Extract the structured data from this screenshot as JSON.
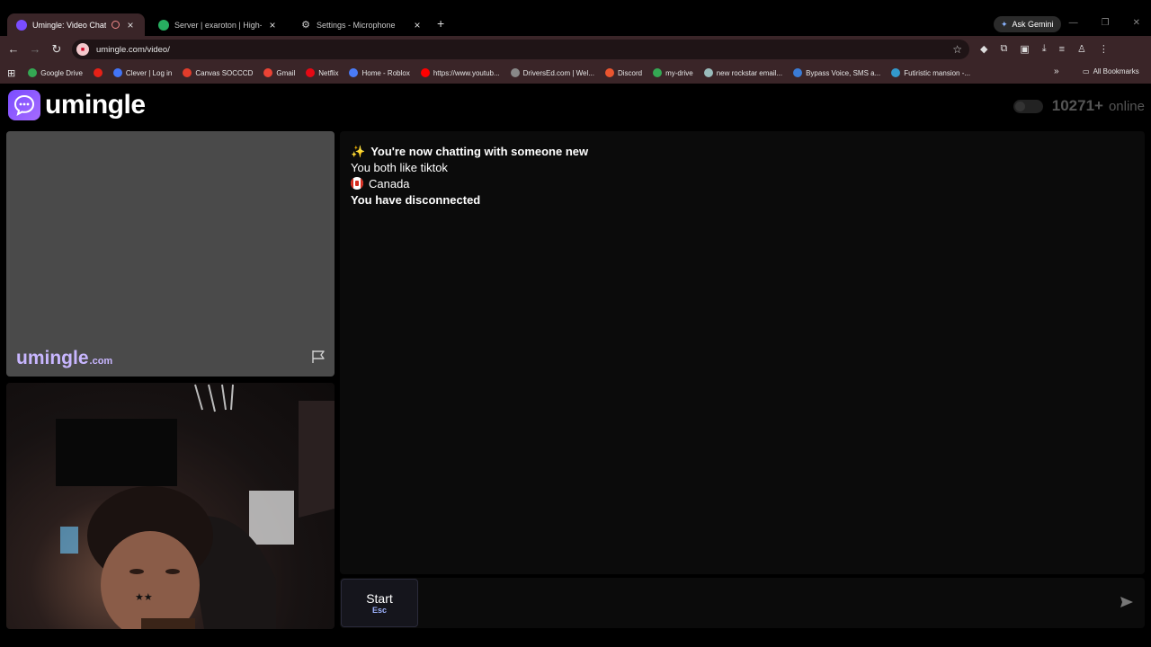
{
  "browser": {
    "tabs": [
      {
        "title": "Umingle: Video Chat with St",
        "active": true,
        "recording": true
      },
      {
        "title": "Server | exaroton | High-end on",
        "active": false
      },
      {
        "title": "Settings - Microphone",
        "active": false
      }
    ],
    "new_tab": "+",
    "gemini_label": "Ask Gemini",
    "url": "umingle.com/video/",
    "bookmarks": [
      {
        "label": "Google Drive",
        "color": "#34a853"
      },
      {
        "label": "",
        "color": "#e62117"
      },
      {
        "label": "Clever | Log in",
        "color": "#4274f6"
      },
      {
        "label": "Canvas SOCCCD",
        "color": "#e13c2b"
      },
      {
        "label": "Gmail",
        "color": "#ea4335"
      },
      {
        "label": "Netflix",
        "color": "#e50914"
      },
      {
        "label": "Home - Roblox",
        "color": "#4a7bf7"
      },
      {
        "label": "https://www.youtub...",
        "color": "#ff0000"
      },
      {
        "label": "DriversEd.com | Wel...",
        "color": "#888888"
      },
      {
        "label": "Discord",
        "color": "#e9552f"
      },
      {
        "label": "my-drive",
        "color": "#34a853"
      },
      {
        "label": "new rockstar email...",
        "color": "#9bb"
      },
      {
        "label": "Bypass Voice, SMS a...",
        "color": "#3a7bd5"
      },
      {
        "label": "Futiristic mansion -...",
        "color": "#3399cc"
      }
    ],
    "more_bookmarks": "»",
    "all_bookmarks": "All Bookmarks"
  },
  "site": {
    "logo_text": "umingle",
    "online_count": "10271+",
    "online_label": "online",
    "watermark_main": "umingle",
    "watermark_tld": ".com"
  },
  "chat": {
    "messages": [
      {
        "icon": "✨",
        "text": "You're now chatting with someone new",
        "bold": true
      },
      {
        "icon": "",
        "text": "You both like tiktok",
        "bold": false
      },
      {
        "icon": "🇨🇦",
        "text": "Canada",
        "bold": false
      },
      {
        "icon": "",
        "text": "You have disconnected",
        "bold": true
      }
    ],
    "start_label": "Start",
    "start_key": "Esc",
    "input_value": "",
    "input_placeholder": ""
  },
  "colors": {
    "accent": "#7a4dff",
    "chrome_bar": "#3a2528"
  }
}
